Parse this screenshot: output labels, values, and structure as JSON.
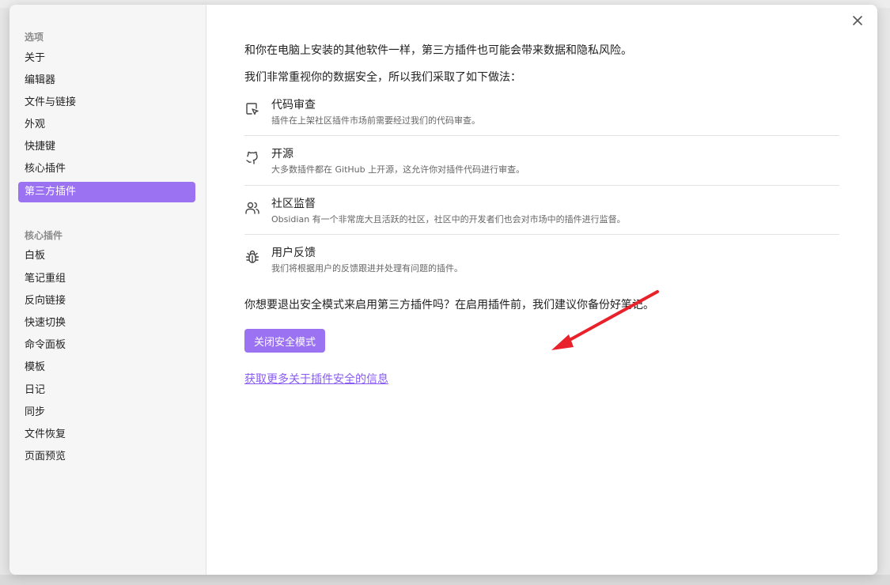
{
  "sidebar": {
    "options_title": "选项",
    "options": [
      {
        "label": "关于"
      },
      {
        "label": "编辑器"
      },
      {
        "label": "文件与链接"
      },
      {
        "label": "外观"
      },
      {
        "label": "快捷键"
      },
      {
        "label": "核心插件"
      },
      {
        "label": "第三方插件",
        "active": true
      }
    ],
    "core_title": "核心插件",
    "core_plugins": [
      {
        "label": "白板"
      },
      {
        "label": "笔记重组"
      },
      {
        "label": "反向链接"
      },
      {
        "label": "快速切换"
      },
      {
        "label": "命令面板"
      },
      {
        "label": "模板"
      },
      {
        "label": "日记"
      },
      {
        "label": "同步"
      },
      {
        "label": "文件恢复"
      },
      {
        "label": "页面预览"
      }
    ]
  },
  "content": {
    "intro": "和你在电脑上安装的其他软件一样，第三方插件也可能会带来数据和隐私风险。",
    "intro2": "我们非常重视你的数据安全，所以我们采取了如下做法：",
    "features": [
      {
        "icon": "code-review-icon",
        "title": "代码审查",
        "desc": "插件在上架社区插件市场前需要经过我们的代码审查。"
      },
      {
        "icon": "github-icon",
        "title": "开源",
        "desc": "大多数插件都在 GitHub 上开源，这允许你对插件代码进行审查。"
      },
      {
        "icon": "users-icon",
        "title": "社区监督",
        "desc": "Obsidian 有一个非常庞大且活跃的社区，社区中的开发者们也会对市场中的插件进行监督。"
      },
      {
        "icon": "bug-icon",
        "title": "用户反馈",
        "desc": "我们将根据用户的反馈跟进并处理有问题的插件。"
      }
    ],
    "question": "你想要退出安全模式来启用第三方插件吗？在启用插件前，我们建议你备份好笔记。",
    "button_label": "关闭安全模式",
    "link_label": "获取更多关于插件安全的信息"
  },
  "colors": {
    "accent": "#9b72f2",
    "link": "#8a5cf5",
    "annotation_arrow": "#e8212a"
  }
}
